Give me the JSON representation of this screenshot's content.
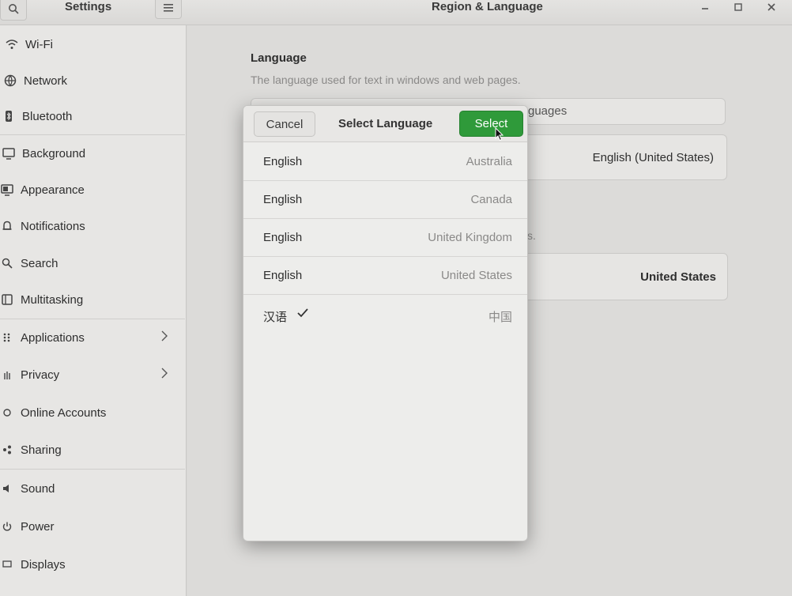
{
  "window": {
    "sidebar_title": "Settings",
    "main_title": "Region & Language"
  },
  "sidebar": {
    "items": [
      {
        "label": "Wi-Fi",
        "icon": "wifi-icon"
      },
      {
        "label": "Network",
        "icon": "network-icon"
      },
      {
        "label": "Bluetooth",
        "icon": "bluetooth-icon"
      },
      {
        "label": "Background",
        "icon": "background-icon"
      },
      {
        "label": "Appearance",
        "icon": "appearance-icon"
      },
      {
        "label": "Notifications",
        "icon": "bell-icon"
      },
      {
        "label": "Search",
        "icon": "search-icon"
      },
      {
        "label": "Multitasking",
        "icon": "multitasking-icon"
      },
      {
        "label": "Applications",
        "icon": "apps-grid-icon"
      },
      {
        "label": "Privacy",
        "icon": "hand-icon"
      },
      {
        "label": "Online Accounts",
        "icon": "cloud-icon"
      },
      {
        "label": "Sharing",
        "icon": "share-icon"
      },
      {
        "label": "Sound",
        "icon": "speaker-icon"
      },
      {
        "label": "Power",
        "icon": "power-icon"
      },
      {
        "label": "Displays",
        "icon": "display-icon"
      }
    ]
  },
  "main": {
    "language_heading": "Language",
    "language_description": "The language used for text in windows and web pages.",
    "manage_languages_fragment": "guages",
    "language_value": "English (United States)",
    "formats_desc_fragment": "s.",
    "formats_value": "United States"
  },
  "dialog": {
    "title": "Select Language",
    "cancel_label": "Cancel",
    "select_label": "Select",
    "accent": "#2f9a3a",
    "languages": [
      {
        "name": "English",
        "region": "Australia",
        "selected": false
      },
      {
        "name": "English",
        "region": "Canada",
        "selected": false
      },
      {
        "name": "English",
        "region": "United Kingdom",
        "selected": false
      },
      {
        "name": "English",
        "region": "United States",
        "selected": false
      },
      {
        "name": "汉语",
        "region": "中国",
        "selected": true
      }
    ]
  }
}
